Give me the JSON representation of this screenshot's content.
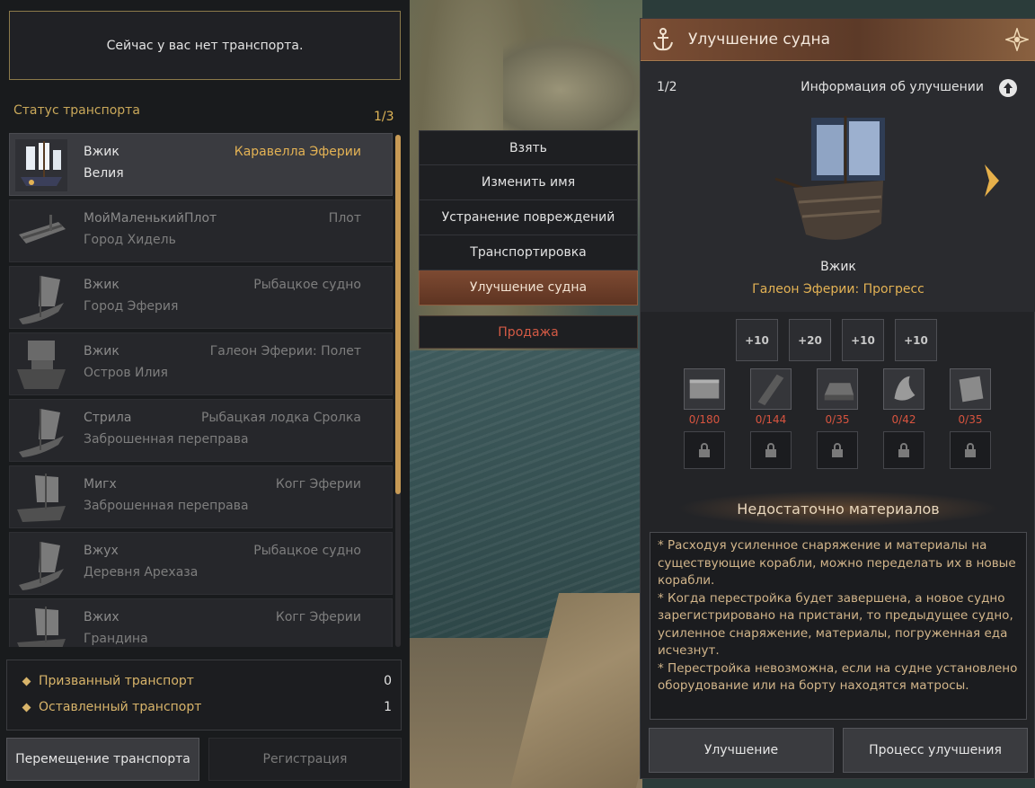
{
  "left_panel": {
    "no_transport_message": "Сейчас у вас нет транспорта.",
    "status_title": "Статус транспорта",
    "status_count": "1/3",
    "vehicles": [
      {
        "name": "Вжик",
        "type": "Каравелла Эферии",
        "location": "Велия",
        "selected": true,
        "icon": "caravel-icon"
      },
      {
        "name": "МойМаленькийПлот",
        "type": "Плот",
        "location": "Город Хидель",
        "selected": false,
        "icon": "raft-icon"
      },
      {
        "name": "Вжик",
        "type": "Рыбацкое судно",
        "location": "Город Эферия",
        "selected": false,
        "icon": "fishing-boat-icon"
      },
      {
        "name": "Вжик",
        "type": "Галеон Эферии: Полет",
        "location": "Остров Илия",
        "selected": false,
        "icon": "galleon-icon"
      },
      {
        "name": "Стрила",
        "type": "Рыбацкая лодка Сролка",
        "location": "Заброшенная переправа",
        "selected": false,
        "icon": "fishing-boat-icon"
      },
      {
        "name": "Мигх",
        "type": "Когг Эферии",
        "location": "Заброшенная переправа",
        "selected": false,
        "icon": "cog-icon"
      },
      {
        "name": "Вжух",
        "type": "Рыбацкое судно",
        "location": "Деревня Арехаза",
        "selected": false,
        "icon": "fishing-boat-icon"
      },
      {
        "name": "Вжих",
        "type": "Когг Эферии",
        "location": "Грандина",
        "selected": false,
        "icon": "cog-icon"
      }
    ],
    "summary": {
      "summoned_label": "Призванный транспорт",
      "summoned_value": "0",
      "left_label": "Оставленный транспорт",
      "left_value": "1"
    },
    "move_button": "Перемещение транспорта",
    "register_button": "Регистрация"
  },
  "context_menu": {
    "items": [
      "Взять",
      "Изменить имя",
      "Устранение повреждений",
      "Транспортировка",
      "Улучшение судна"
    ],
    "active_index": 4,
    "sell": "Продажа"
  },
  "upgrade_panel": {
    "title": "Улучшение судна",
    "page": "1/2",
    "info_label": "Информация об улучшении",
    "ship_name": "Вжик",
    "ship_class": "Галеон Эферии: Прогресс",
    "equipment": [
      "+10",
      "+20",
      "+10",
      "+10"
    ],
    "materials": [
      {
        "count": "0/180",
        "icon": "timber-icon"
      },
      {
        "count": "0/144",
        "icon": "plank-icon"
      },
      {
        "count": "0/35",
        "icon": "ingot-icon"
      },
      {
        "count": "0/42",
        "icon": "cloth-icon"
      },
      {
        "count": "0/35",
        "icon": "stone-icon"
      }
    ],
    "status_message": "Недостаточно материалов",
    "notes": [
      "* Расходуя усиленное снаряжение и материалы на существующие корабли, можно переделать их в новые корабли.",
      "* Когда перестройка будет завершена, а новое судно зарегистрировано на пристани, то предыдущее судно, усиленное снаряжение, материалы, погруженная еда исчезнут.",
      "* Перестройка невозможна, если на судне установлено оборудование или на борту находятся матросы."
    ],
    "upgrade_button": "Улучшение",
    "progress_button": "Процесс улучшения"
  },
  "colors": {
    "accent_gold": "#e3b254",
    "warning_red": "#d8543f",
    "active_menu": "#7d4a32"
  }
}
